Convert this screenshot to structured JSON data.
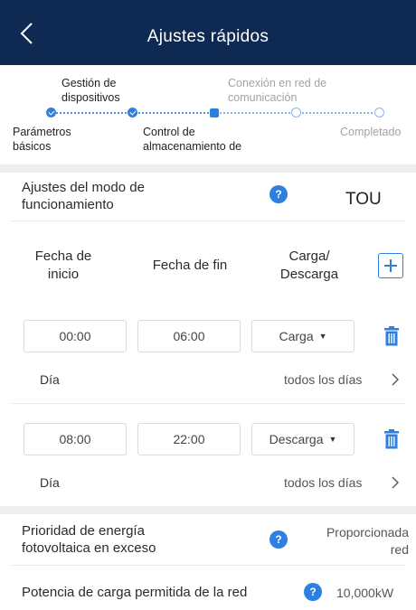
{
  "header": {
    "title": "Ajustes rápidos"
  },
  "stepper": {
    "steps": [
      {
        "label": "Parámetros básicos",
        "state": "done"
      },
      {
        "label": "Gestión de dispositivos",
        "state": "done"
      },
      {
        "label": "Control de almacenamiento de",
        "state": "current"
      },
      {
        "label": "Conexión en red de comunicación",
        "state": "pending"
      },
      {
        "label": "Completado",
        "state": "pending"
      }
    ]
  },
  "mode": {
    "label": "Ajustes del modo de funcionamiento",
    "value": "TOU"
  },
  "table": {
    "col_start": "Fecha de inicio",
    "col_end": "Fecha de fin",
    "col_mode": "Carga/ Descarga"
  },
  "entries": [
    {
      "start": "00:00",
      "end": "06:00",
      "mode": "Carga",
      "day_label": "Día",
      "day_value": "todos los días"
    },
    {
      "start": "08:00",
      "end": "22:00",
      "mode": "Descarga",
      "day_label": "Día",
      "day_value": "todos los días"
    }
  ],
  "pv_priority": {
    "label": "Prioridad de energía fotovoltaica en exceso",
    "value": "Proporcionada red"
  },
  "grid_power": {
    "label": "Potencia de carga permitida de la red",
    "value": "10,000kW"
  },
  "colors": {
    "header": "#0e2a52",
    "accent": "#2d7fe0"
  },
  "icons": {
    "back": "chevron-left-icon",
    "help": "help-icon",
    "add": "plus-icon",
    "delete": "trash-icon",
    "more": "chevron-right-icon"
  }
}
